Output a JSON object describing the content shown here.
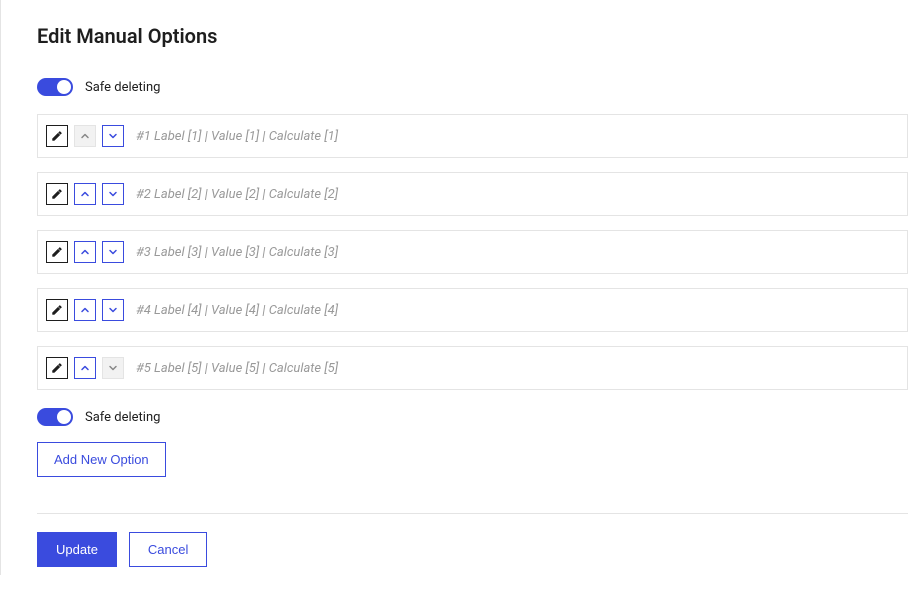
{
  "title": "Edit Manual Options",
  "safe_deleting_label": "Safe deleting",
  "options": [
    {
      "text": "#1 Label [1] | Value [1] | Calculate [1]",
      "up_enabled": false,
      "down_enabled": true
    },
    {
      "text": "#2 Label [2] | Value [2] | Calculate [2]",
      "up_enabled": true,
      "down_enabled": true
    },
    {
      "text": "#3 Label [3] | Value [3] | Calculate [3]",
      "up_enabled": true,
      "down_enabled": true
    },
    {
      "text": "#4 Label [4] | Value [4] | Calculate [4]",
      "up_enabled": true,
      "down_enabled": true
    },
    {
      "text": "#5 Label [5] | Value [5] | Calculate [5]",
      "up_enabled": true,
      "down_enabled": false
    }
  ],
  "add_button_label": "Add New Option",
  "update_button_label": "Update",
  "cancel_button_label": "Cancel"
}
